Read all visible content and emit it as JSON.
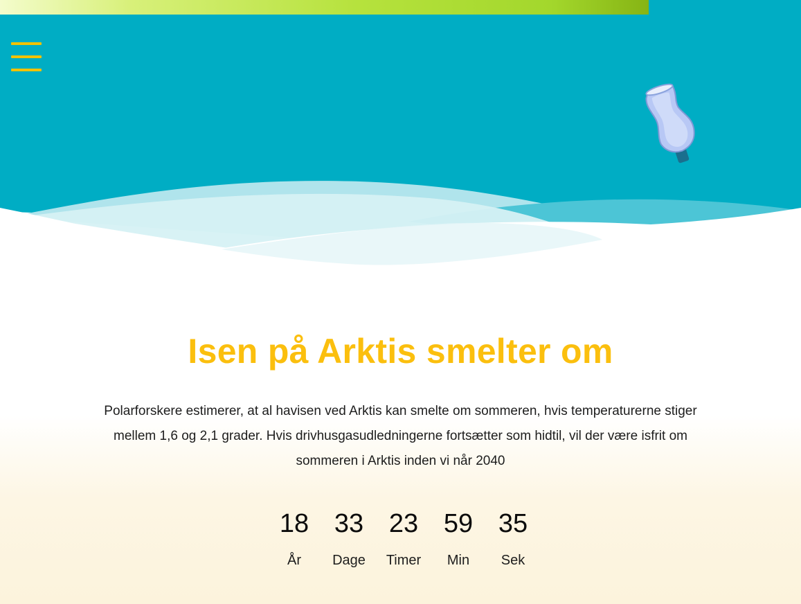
{
  "progress": {
    "value_pct": 81
  },
  "header": {
    "menu_icon": "hamburger-menu-icon"
  },
  "decoration": {
    "floating_object_icon": "plastic-bottle-icon"
  },
  "colors": {
    "ocean": "#00adc4",
    "accent_yellow": "#fbbf0e",
    "progress_green": "#a3d72c"
  },
  "main": {
    "title": "Isen på Arktis smelter om",
    "description": "Polarforskere estimerer, at al havisen ved Arktis kan smelte om sommeren, hvis temperaturerne stiger mellem 1,6 og 2,1 grader. Hvis drivhusgasudledningerne fortsætter som hidtil, vil der være isfrit om sommeren i Arktis inden vi når 2040"
  },
  "countdown": [
    {
      "value": "18",
      "label": "År"
    },
    {
      "value": "33",
      "label": "Dage"
    },
    {
      "value": "23",
      "label": "Timer"
    },
    {
      "value": "59",
      "label": "Min"
    },
    {
      "value": "35",
      "label": "Sek"
    }
  ]
}
